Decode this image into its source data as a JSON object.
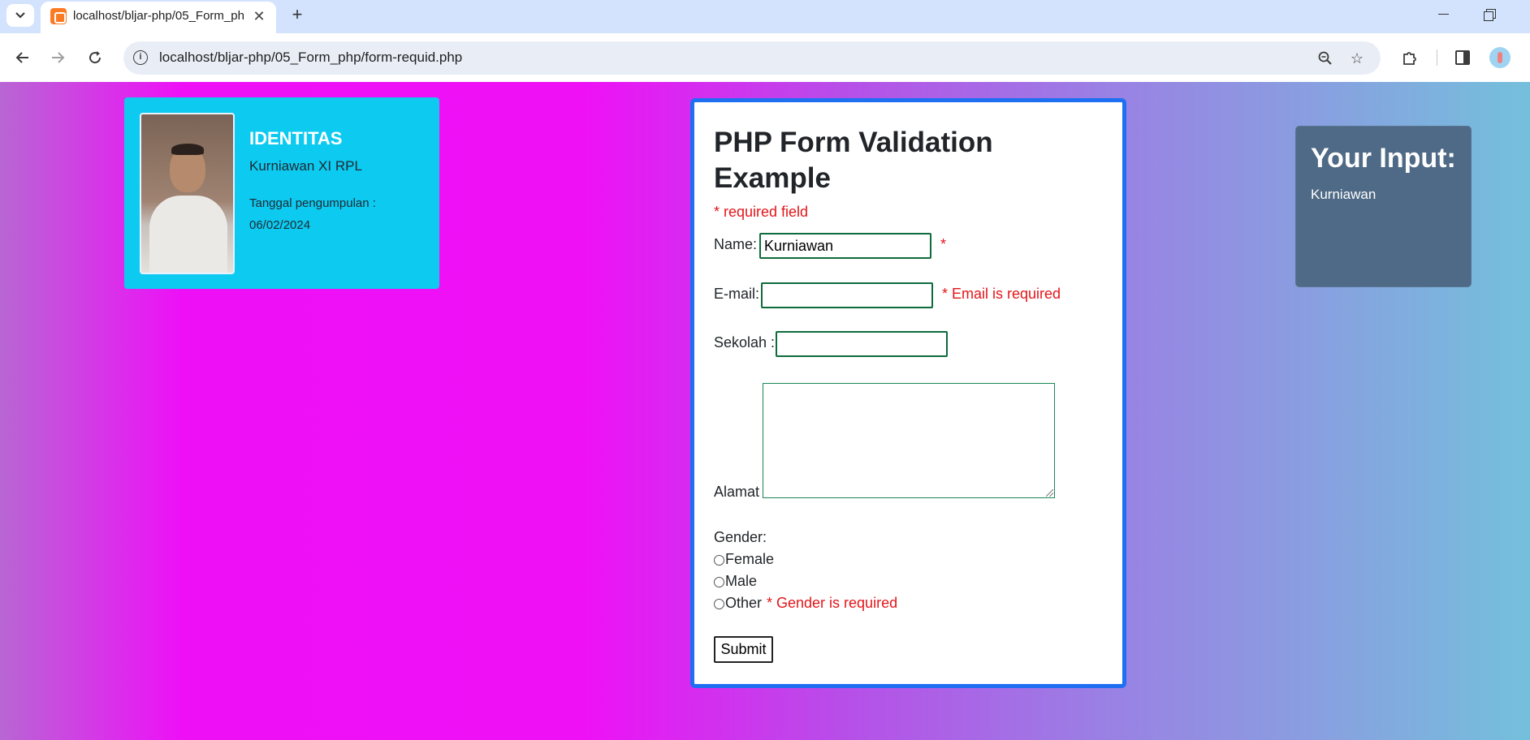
{
  "browser": {
    "tab_title": "localhost/bljar-php/05_Form_php/form-requid.php",
    "url": "localhost/bljar-php/05_Form_php/form-requid.php",
    "icons": {
      "tab_list": "chevron-down-icon",
      "close_tab": "close-icon",
      "new_tab": "plus-icon",
      "back": "arrow-left-icon",
      "forward": "arrow-right-icon",
      "reload": "reload-icon",
      "zoom": "zoom-out-icon",
      "bookmark": "star-icon",
      "extensions": "puzzle-icon",
      "side_panel": "side-panel-icon"
    }
  },
  "identity": {
    "title": "IDENTITAS",
    "name": "Kurniawan XI RPL",
    "date_label": "Tanggal pengumpulan :",
    "date": "06/02/2024"
  },
  "form": {
    "title": "PHP Form Validation Example",
    "required_note": "* required field",
    "name_label": "Name:",
    "name_value": "Kurniawan",
    "name_error": "*",
    "email_label": "E-mail:",
    "email_value": "",
    "email_error": "* Email is required",
    "school_label": "Sekolah :",
    "school_value": "",
    "address_label": "Alamat",
    "gender_label": "Gender:",
    "gender_options": [
      "Female",
      "Male",
      "Other"
    ],
    "gender_error": "* Gender is required",
    "submit_label": "Submit"
  },
  "output": {
    "title": "Your Input:",
    "value": "Kurniawan"
  },
  "colors": {
    "identity_card": "#0dcaf0",
    "form_border": "#1e6ff2",
    "error_text": "#e3161a",
    "output_card": "#4f6a86"
  }
}
